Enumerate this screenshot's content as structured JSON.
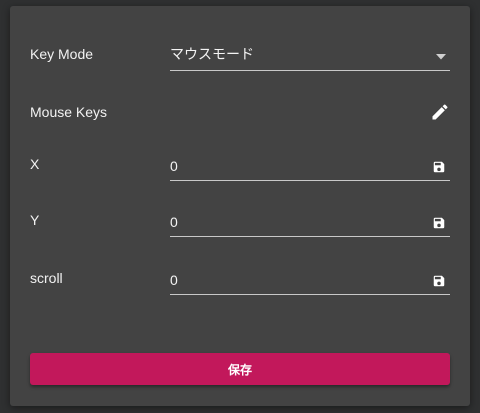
{
  "key_mode": {
    "label": "Key Mode",
    "selected": "マウスモード",
    "dropdown_icon": "triangle-down-icon"
  },
  "mouse_keys": {
    "label": "Mouse Keys",
    "edit_icon": "pencil-icon"
  },
  "fields": {
    "x": {
      "label": "X",
      "value": "0",
      "icon": "save-icon"
    },
    "y": {
      "label": "Y",
      "value": "0",
      "icon": "save-icon"
    },
    "scroll": {
      "label": "scroll",
      "value": "0",
      "icon": "save-icon"
    }
  },
  "save_button": {
    "label": "保存"
  },
  "colors": {
    "dialog_bg": "#434343",
    "page_bg": "#2f3031",
    "accent": "#c2185b",
    "text": "#f2f2f2"
  }
}
